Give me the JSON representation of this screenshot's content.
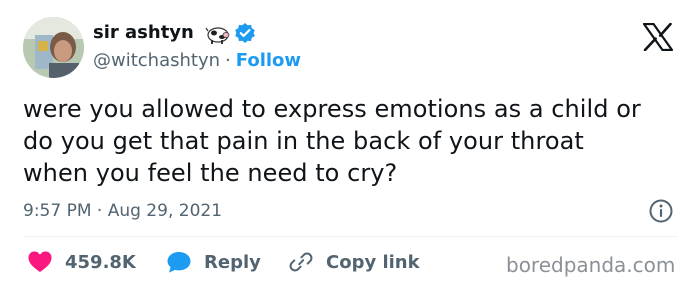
{
  "author": {
    "display_name": "sir ashtyn",
    "handle": "@witchashtyn",
    "separator": "·",
    "follow_label": "Follow",
    "name_emoji_icon": "cow-emoji-icon",
    "verified_icon": "verified-badge-icon",
    "avatar_icon": "avatar"
  },
  "platform": {
    "logo_icon": "x-logo-icon"
  },
  "tweet": {
    "text": "were you allowed to express emotions as a child or\ndo you get that pain in the back of your throat\nwhen you feel the need to cry?",
    "timestamp": "9:57 PM · Aug 29, 2021",
    "info_icon": "info-icon"
  },
  "actions": {
    "like": {
      "count": "459.8K",
      "icon": "heart-icon"
    },
    "reply": {
      "label": "Reply",
      "icon": "reply-bubble-icon"
    },
    "copy_link": {
      "label": "Copy link",
      "icon": "link-icon"
    }
  },
  "watermark": {
    "text": "boredpanda.com"
  },
  "colors": {
    "link_blue": "#1d9bf0",
    "like_red": "#f91880",
    "text_primary": "#0f1419",
    "text_secondary": "#536471",
    "divider": "#eff3f4"
  }
}
